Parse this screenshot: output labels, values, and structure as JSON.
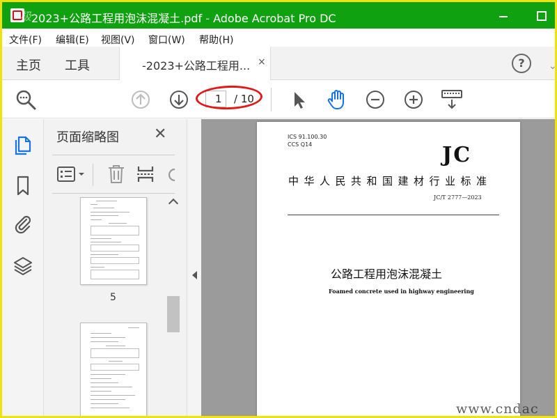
{
  "window": {
    "watermark": "极",
    "title": "2023+公路工程用泡沫混凝土.pdf - Adobe Acrobat Pro DC"
  },
  "menu": [
    "文件(F)",
    "编辑(E)",
    "视图(V)",
    "窗口(W)",
    "帮助(H)"
  ],
  "tabs": {
    "home": "主页",
    "tools": "工具",
    "document": "-2023+公路工程用...",
    "close": "×"
  },
  "toolbar": {
    "page_current": "1",
    "page_total": "/ 10"
  },
  "thumbnails": {
    "title": "页面缩略图",
    "close": "✕",
    "page_label": "5"
  },
  "document": {
    "ics": "ICS 91.100.30",
    "ccs": "CCS Q14",
    "brand": "JC",
    "standard": "中华人民共和国建材行业标准",
    "code": "JC/T 2777—2023",
    "title_cn": "公路工程用泡沫混凝土",
    "title_en": "Foamed concrete used in highway engineering"
  },
  "site_watermark": "www.cndac",
  "colors": {
    "titlebar": "#10a110",
    "frame": "#f1e30a",
    "hand_tool": "#1473e6",
    "highlight": "#e01919"
  },
  "icons": [
    "search-icon",
    "page-up-icon",
    "page-down-icon",
    "select-arrow-icon",
    "hand-icon",
    "zoom-out-icon",
    "zoom-in-icon",
    "keyboard-scroll-icon",
    "pages-icon",
    "bookmark-icon",
    "attachment-icon",
    "layers-icon",
    "help-icon",
    "trash-icon",
    "options-icon"
  ]
}
